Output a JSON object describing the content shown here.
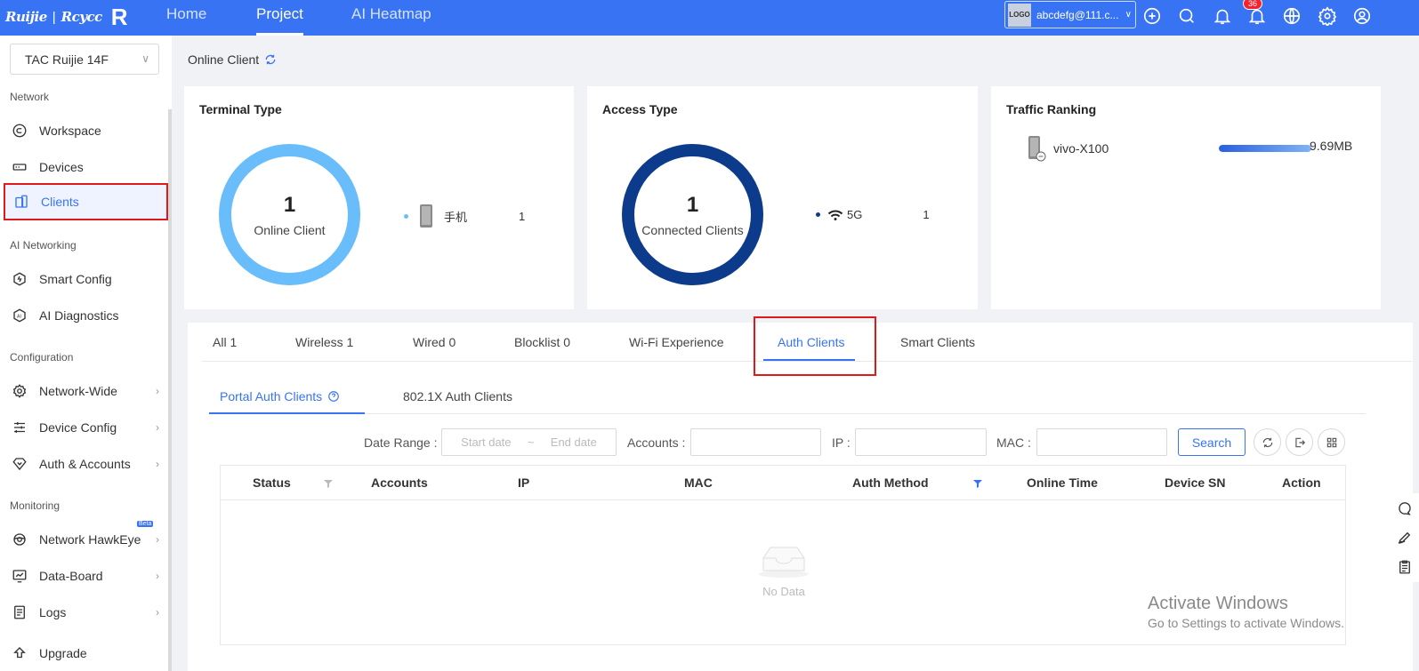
{
  "topbar": {
    "brand": "Ruijie",
    "brand_sub": "Rcycc",
    "brand_mark": "R",
    "nav": [
      {
        "label": "Home"
      },
      {
        "label": "Project"
      },
      {
        "label": "AI Heatmap"
      }
    ],
    "account": {
      "logo": "LOGO",
      "email": "abcdefg@111.c..."
    },
    "notification_count": "36",
    "icons": [
      "add-circle-icon",
      "search-icon",
      "notification-bell-icon",
      "alert-bell-icon",
      "globe-icon",
      "settings-gear-icon",
      "user-profile-icon"
    ]
  },
  "sidebar": {
    "project": "TAC  Ruijie  14F",
    "sections": {
      "network": "Network",
      "ai_networking": "AI Networking",
      "configuration": "Configuration",
      "monitoring": "Monitoring"
    },
    "items": {
      "workspace": "Workspace",
      "devices": "Devices",
      "clients": "Clients",
      "smart_config": "Smart Config",
      "ai_diagnostics": "AI Diagnostics",
      "network_wide": "Network-Wide",
      "device_config": "Device Config",
      "auth_accounts": "Auth & Accounts",
      "network_hawkeye": "Network HawkEye",
      "data_board": "Data-Board",
      "logs": "Logs",
      "upgrade": "Upgrade"
    },
    "beta_badge": "Beta"
  },
  "breadcrumb": "Online Client",
  "cards": {
    "terminal_type": {
      "title": "Terminal Type",
      "count": "1",
      "label": "Online Client",
      "legend": {
        "name": "手机",
        "value": "1"
      }
    },
    "access_type": {
      "title": "Access Type",
      "count": "1",
      "label": "Connected Clients",
      "legend": {
        "name": "5G",
        "value": "1"
      }
    },
    "traffic_ranking": {
      "title": "Traffic Ranking",
      "device": "vivo-X100",
      "value": "9.69MB",
      "fill_fraction": 1.0
    }
  },
  "tabs": {
    "all": "All  1",
    "wireless": "Wireless  1",
    "wired": "Wired  0",
    "blocklist": "Blocklist  0",
    "wifi_experience": "Wi-Fi Experience",
    "auth_clients": "Auth Clients",
    "smart_clients": "Smart Clients"
  },
  "subtabs": {
    "portal": "Portal Auth Clients",
    "dot1x": "802.1X Auth Clients"
  },
  "filters": {
    "date_range_label": "Date Range :",
    "start_placeholder": "Start date",
    "tilde": "~",
    "end_placeholder": "End date",
    "accounts_label": "Accounts :",
    "ip_label": "IP :",
    "mac_label": "MAC :",
    "search_button": "Search"
  },
  "table": {
    "columns": {
      "status": "Status",
      "accounts": "Accounts",
      "ip": "IP",
      "mac": "MAC",
      "auth_method": "Auth Method",
      "online_time": "Online Time",
      "device_sn": "Device SN",
      "action": "Action"
    },
    "empty_text": "No Data"
  },
  "watermark": {
    "title": "Activate Windows",
    "subtitle": "Go to Settings to activate Windows."
  },
  "colors": {
    "primary": "#3873f4",
    "highlight": "#e01a1a",
    "ring_terminal": "#69bdfb",
    "ring_access": "#0d3b8c"
  }
}
